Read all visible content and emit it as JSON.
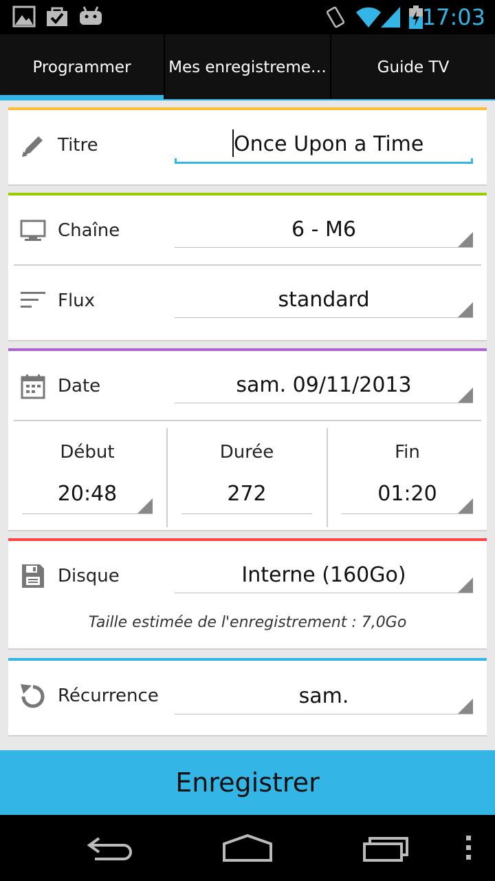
{
  "status_bar": {
    "time": "17:03",
    "icons": [
      "image-icon",
      "shopping-bag-icon",
      "android-icon",
      "vibrate-icon",
      "wifi-icon",
      "signal-icon",
      "battery-charging-icon"
    ]
  },
  "tabs": [
    {
      "label": "Programmer",
      "selected": true
    },
    {
      "label": "Mes enregistreme…",
      "selected": false
    },
    {
      "label": "Guide TV",
      "selected": false
    }
  ],
  "form": {
    "titre": {
      "label": "Titre",
      "value": "Once Upon a Time",
      "icon": "pencil-icon"
    },
    "chaine": {
      "label": "Chaîne",
      "value": "6 - M6",
      "icon": "monitor-icon"
    },
    "flux": {
      "label": "Flux",
      "value": "standard",
      "icon": "sort-lines-icon"
    },
    "date": {
      "label": "Date",
      "value": "sam. 09/11/2013",
      "icon": "calendar-icon"
    },
    "debut": {
      "label": "Début",
      "value": "20:48"
    },
    "duree": {
      "label": "Durée",
      "value": "272"
    },
    "fin": {
      "label": "Fin",
      "value": "01:20"
    },
    "disque": {
      "label": "Disque",
      "value": "Interne (160Go)",
      "icon": "floppy-disk-icon",
      "hint": "Taille estimée de l'enregistrement : 7,0Go"
    },
    "recurrence": {
      "label": "Récurrence",
      "value": "sam.",
      "icon": "refresh-icon"
    }
  },
  "accent_colors": {
    "titre": "#ffbb33",
    "chaine_flux": "#99cc00",
    "date": "#aa66cc",
    "disque": "#ff4444",
    "recurrence": "#33b5e5"
  },
  "record_button": "Enregistrer",
  "nav_bar": [
    "back-icon",
    "home-icon",
    "recent-apps-icon",
    "overflow-menu-icon"
  ]
}
